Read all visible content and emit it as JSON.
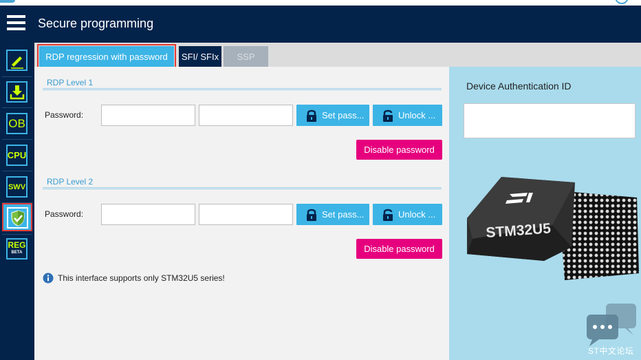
{
  "header": {
    "title": "Secure programming"
  },
  "sidebar": {
    "items": [
      {
        "name": "memory-edit",
        "label": ""
      },
      {
        "name": "download",
        "label": ""
      },
      {
        "name": "option-bytes",
        "label": "OB"
      },
      {
        "name": "cpu",
        "label": "CPU"
      },
      {
        "name": "swv",
        "label": "SWV"
      },
      {
        "name": "secure-programming",
        "label": ""
      },
      {
        "name": "registers",
        "label": "REG",
        "sublabel": "BETA"
      }
    ]
  },
  "tabs": [
    {
      "label": "RDP regression with password",
      "active": true
    },
    {
      "label": "SFI/ SFIx",
      "active": false
    },
    {
      "label": "SSP",
      "active": false,
      "disabled": true
    }
  ],
  "rdp_level1": {
    "title": "RDP Level 1",
    "password_label": "Password:",
    "password_value": "",
    "confirm_value": "",
    "set_button": "Set pass...",
    "unlock_button": "Unlock ...",
    "disable_button": "Disable password"
  },
  "rdp_level2": {
    "title": "RDP Level 2",
    "password_label": "Password:",
    "password_value": "",
    "confirm_value": "",
    "set_button": "Set pass...",
    "unlock_button": "Unlock ...",
    "disable_button": "Disable password"
  },
  "info": {
    "text": "This interface supports only STM32U5 series!"
  },
  "device_auth": {
    "label": "Device Authentication ID",
    "value": ""
  },
  "chip": {
    "brand": "ST",
    "model": "STM32U5"
  },
  "watermark": {
    "text": "ST中文论坛"
  },
  "colors": {
    "navy": "#03234b",
    "accent_blue": "#3cb4e6",
    "pink": "#e6007e",
    "lime": "#c8ff00",
    "right_panel": "#a9dbec"
  }
}
